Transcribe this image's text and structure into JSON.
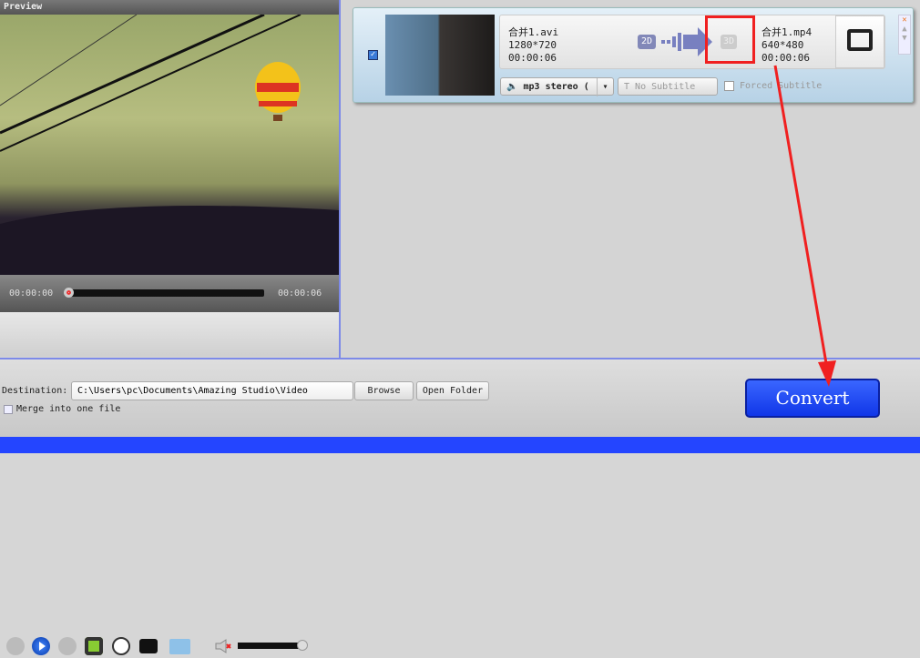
{
  "preview": {
    "title": "Preview",
    "time_current": "00:00:00",
    "time_total": "00:00:06",
    "progress": 0,
    "volume": 0.85
  },
  "file": {
    "checked": true,
    "source_name": "合并1.avi",
    "source_resolution": "1280*720",
    "source_duration": "00:00:06",
    "badge_2d": "2D",
    "badge_3d": "3D",
    "output_name": "合并1.mp4",
    "output_resolution": "640*480",
    "output_duration": "00:00:06",
    "audio": "mp3 stereo (",
    "subtitle": "No Subtitle",
    "forced_subtitle": "Forced Subtitle"
  },
  "bottom": {
    "destination_label": "Destination:",
    "destination_value": "C:\\Users\\pc\\Documents\\Amazing Studio\\Video",
    "browse": "Browse",
    "open_folder": "Open Folder",
    "merge_label": "Merge into one file",
    "convert": "Convert"
  },
  "colors": {
    "accent": "#2445ff",
    "highlight": "#ff2020"
  }
}
